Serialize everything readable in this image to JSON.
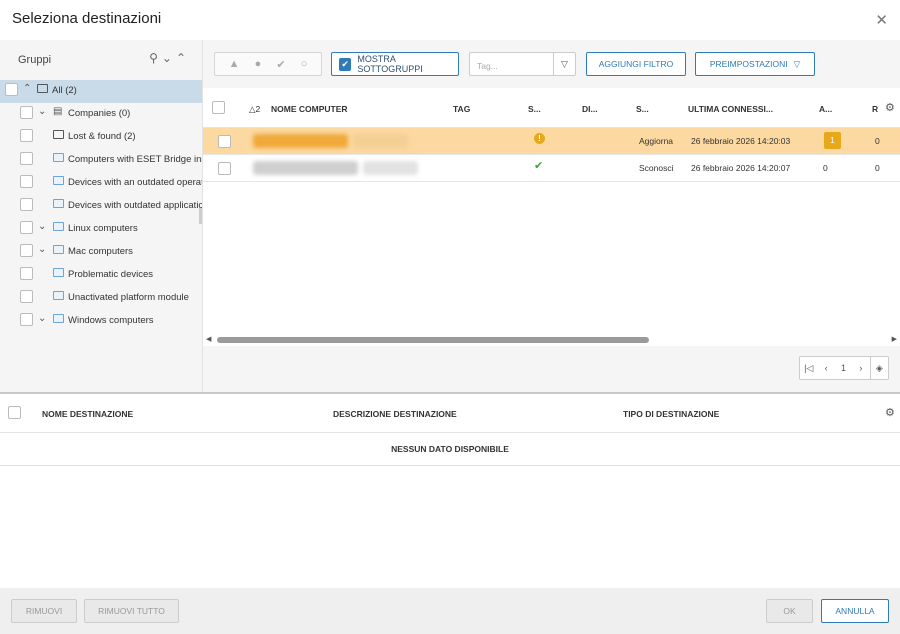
{
  "dialog": {
    "title": "Seleziona destinazioni"
  },
  "groups": {
    "label": "Gruppi",
    "items": [
      {
        "label": "All (2)"
      },
      {
        "label": "Companies (0)"
      },
      {
        "label": "Lost & found (2)"
      },
      {
        "label": "Computers with ESET Bridge inst"
      },
      {
        "label": "Devices with an outdated operat"
      },
      {
        "label": "Devices with outdated applicatic"
      },
      {
        "label": "Linux computers"
      },
      {
        "label": "Mac computers"
      },
      {
        "label": "Problematic devices"
      },
      {
        "label": "Unactivated platform module"
      },
      {
        "label": "Windows computers"
      }
    ]
  },
  "toolbar": {
    "show_subgroups": "MOSTRA SOTTOGRUPPI",
    "tag_placeholder": "Tag...",
    "add_filter": "AGGIUNGI FILTRO",
    "presets": "PREIMPOSTAZIONI"
  },
  "table": {
    "sort_indicator": "△2",
    "columns": [
      "NOME COMPUTER",
      "TAG",
      "S...",
      "DI...",
      "S...",
      "ULTIMA CONNESSI...",
      "A...",
      "R"
    ],
    "rows": [
      {
        "status_word": "Aggiorna",
        "last_connection": "26 febbraio 2026 14:20:03",
        "a_value": "1",
        "r_value": "0"
      },
      {
        "status_word": "Sconosci",
        "last_connection": "26 febbraio 2026 14:20:07",
        "a_value": "0",
        "r_value": "0"
      }
    ]
  },
  "pager": {
    "page": "1"
  },
  "destinations": {
    "columns": [
      "NOME DESTINAZIONE",
      "DESCRIZIONE DESTINAZIONE",
      "TIPO DI DESTINAZIONE"
    ],
    "empty": "NESSUN DATO DISPONIBILE"
  },
  "footer": {
    "remove": "RIMUOVI",
    "remove_all": "RIMUOVI TUTTO",
    "ok": "OK",
    "cancel": "ANNULLA"
  },
  "colors": {
    "accent": "#2f7ab9",
    "selected_row": "#fbd9a0",
    "warning": "#e7a81b",
    "ok": "#3fa535"
  }
}
